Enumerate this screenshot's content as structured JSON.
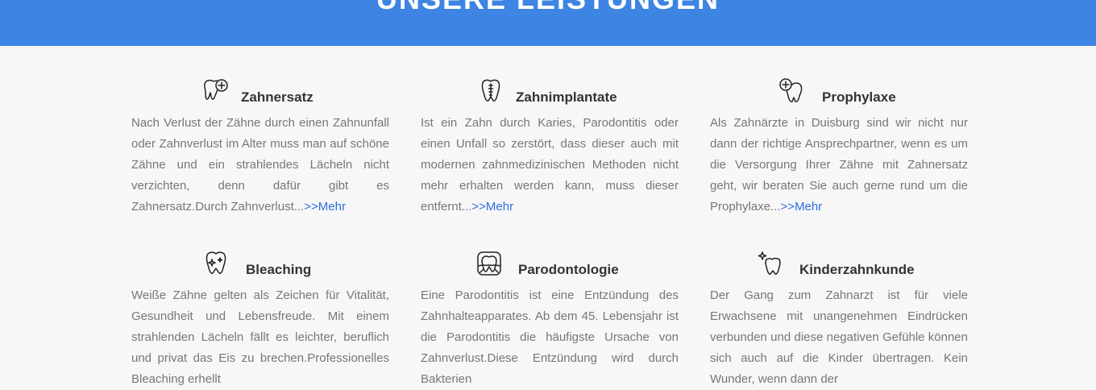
{
  "header": {
    "title": "UNSERE LEISTUNGEN"
  },
  "services": [
    {
      "title": "Zahnersatz",
      "icon": "tooth-plus-icon",
      "text": "Nach Verlust der Zähne durch einen Zahnunfall oder Zahnverlust im Alter muss man auf schöne Zähne und ein strahlendes Lächeln nicht verzichten, denn dafür gibt es Zahnersatz.Durch Zahnverlust...",
      "more": ">>Mehr"
    },
    {
      "title": "Zahnimplantate",
      "icon": "tooth-implant-icon",
      "text": "Ist ein Zahn durch Karies, Parodontitis oder einen Unfall so zerstört, dass dieser auch mit modernen zahnmedizinischen Methoden nicht mehr erhalten werden kann, muss dieser entfernt...",
      "more": ">>Mehr"
    },
    {
      "title": "Prophylaxe",
      "icon": "tooth-magnifier-icon",
      "text": "Als Zahnärzte in Duisburg sind wir nicht nur dann der richtige Ansprechpartner, wenn es um die Versorgung Ihrer Zähne mit Zahnersatz geht, wir beraten Sie auch gerne rund um die Prophylaxe...",
      "more": ">>Mehr"
    },
    {
      "title": "Bleaching",
      "icon": "tooth-sparkle-icon",
      "text": "Weiße Zähne gelten als Zeichen für Vitalität, Gesundheit und Lebensfreude. Mit einem strahlenden Lächeln fällt es leichter, beruflich und privat das Eis zu brechen.Professionelles Bleaching erhellt",
      "more": ""
    },
    {
      "title": "Parodontologie",
      "icon": "gum-tooth-icon",
      "text": "Eine Parodontitis ist eine Entzündung des Zahnhalteapparates. Ab dem 45. Lebensjahr ist die Parodontitis die häufigste Ursache von Zahnverlust.Diese Entzündung wird durch Bakterien",
      "more": ""
    },
    {
      "title": "Kinderzahnkunde",
      "icon": "tooth-star-icon",
      "text": "Der Gang zum Zahnarzt ist für viele Erwachsene mit unangenehmen Eindrücken verbunden und diese negativen Gefühle können sich auch auf die Kinder übertragen. Kein Wunder, wenn dann der",
      "more": ""
    }
  ]
}
